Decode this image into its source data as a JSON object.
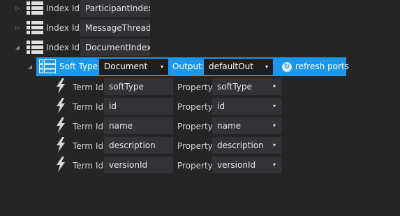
{
  "index_nodes": [
    {
      "label": "Index Id:",
      "value": "ParticipantIndex",
      "expander": "▷",
      "expanded": false
    },
    {
      "label": "Index Id:",
      "value": "MessageThreadIr",
      "expander": "▷",
      "expanded": false
    },
    {
      "label": "Index Id:",
      "value": "DocumentIndex",
      "expander": "◢",
      "expanded": true
    }
  ],
  "soft_type": {
    "expander": "◢",
    "label": "Soft Type:",
    "value": "Document",
    "output_label": "Output:",
    "output_value": "defaultOut",
    "refresh_label": "refresh ports"
  },
  "terms": [
    {
      "term_label": "Term Id",
      "term_value": "softType",
      "prop_label": "Property",
      "prop_value": "softType"
    },
    {
      "term_label": "Term Id",
      "term_value": "id",
      "prop_label": "Property",
      "prop_value": "id"
    },
    {
      "term_label": "Term Id",
      "term_value": "name",
      "prop_label": "Property",
      "prop_value": "name"
    },
    {
      "term_label": "Term Id",
      "term_value": "description",
      "prop_label": "Property",
      "prop_value": "description"
    },
    {
      "term_label": "Term Id",
      "term_value": "versionId",
      "prop_label": "Property",
      "prop_value": "versionId"
    }
  ],
  "icons": {
    "list": "list-icon",
    "bolt": "lightning-icon",
    "refresh": "refresh-icon",
    "dropdown": "▾"
  },
  "colors": {
    "background": "#252526",
    "field": "#333337",
    "accent": "#1c97ea"
  }
}
